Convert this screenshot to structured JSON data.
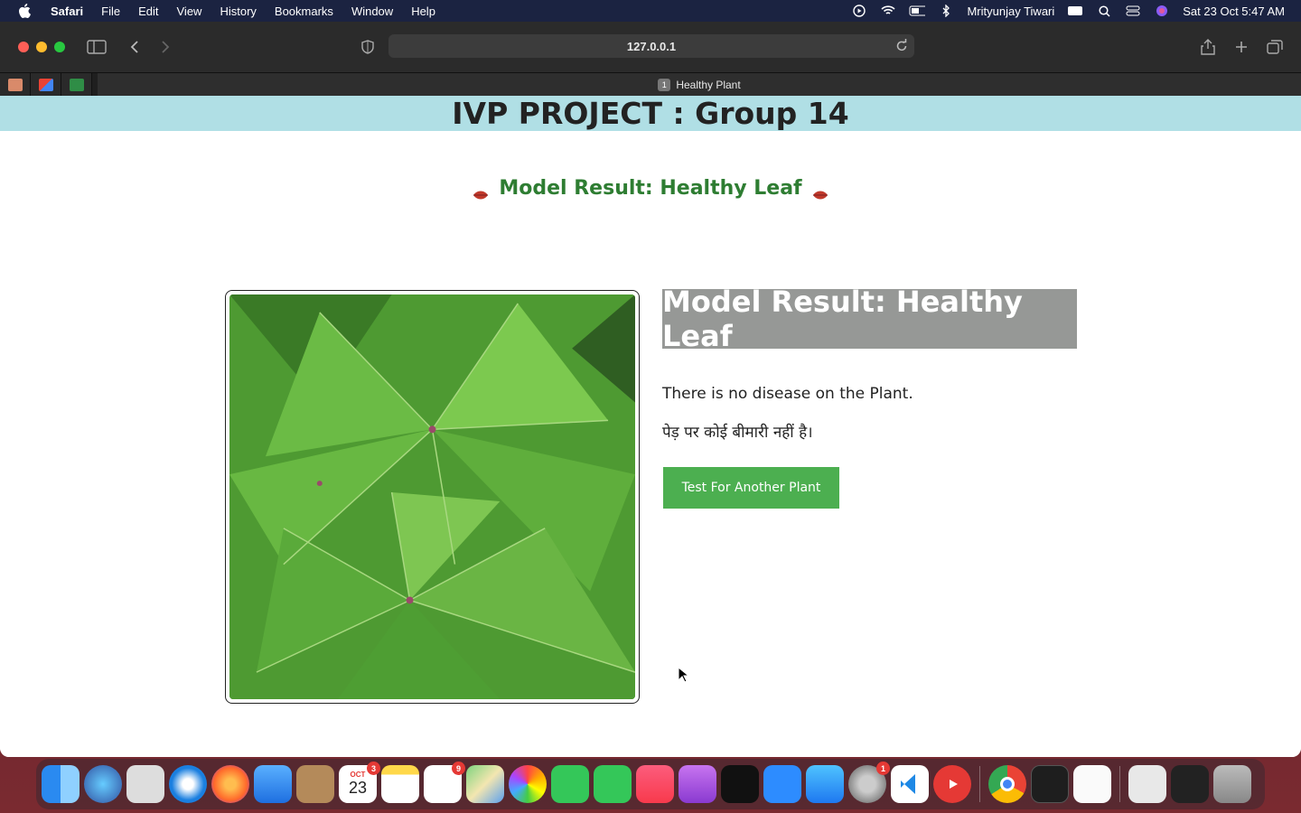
{
  "menubar": {
    "app": "Safari",
    "items": [
      "File",
      "Edit",
      "View",
      "History",
      "Bookmarks",
      "Window",
      "Help"
    ],
    "user": "Mrityunjay Tiwari",
    "datetime": "Sat 23 Oct  5:47 AM"
  },
  "browser": {
    "url": "127.0.0.1",
    "tab_number": "1",
    "tab_title": "Healthy Plant"
  },
  "page": {
    "banner": "IVP PROJECT : Group 14",
    "result_heading": "Model Result: Healthy Leaf",
    "result_box": "Model Result: Healthy Leaf",
    "description_en": "There is no disease on the Plant.",
    "description_hi": "पेड़ पर कोई बीमारी नहीं है।",
    "button_label": "Test For Another Plant"
  },
  "dock": {
    "calendar_month": "OCT",
    "calendar_day": "23",
    "badges": {
      "calendar": "3",
      "reminders": "9",
      "system_preferences": "1"
    }
  },
  "colors": {
    "banner_bg": "#b0dfe5",
    "heading_green": "#2e7d32",
    "result_box_bg": "#969896",
    "button_green": "#4caf50"
  }
}
